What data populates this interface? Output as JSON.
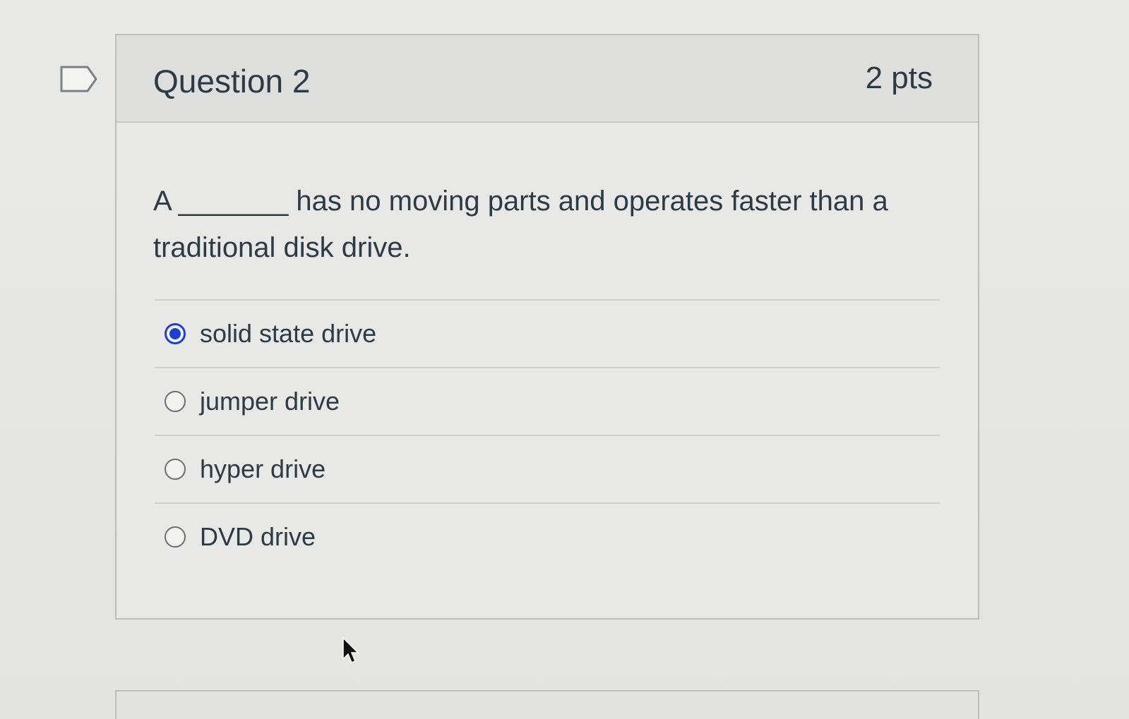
{
  "question": {
    "title": "Question 2",
    "points": "2 pts",
    "text": "A _______ has no moving parts and operates faster than a traditional disk drive.",
    "flag_icon": "flag-icon"
  },
  "answers": [
    {
      "label": "solid state drive",
      "selected": true
    },
    {
      "label": "jumper drive",
      "selected": false
    },
    {
      "label": "hyper drive",
      "selected": false
    },
    {
      "label": "DVD drive",
      "selected": false
    }
  ],
  "colors": {
    "accent": "#1e3fd6",
    "text": "#2d3b45"
  }
}
